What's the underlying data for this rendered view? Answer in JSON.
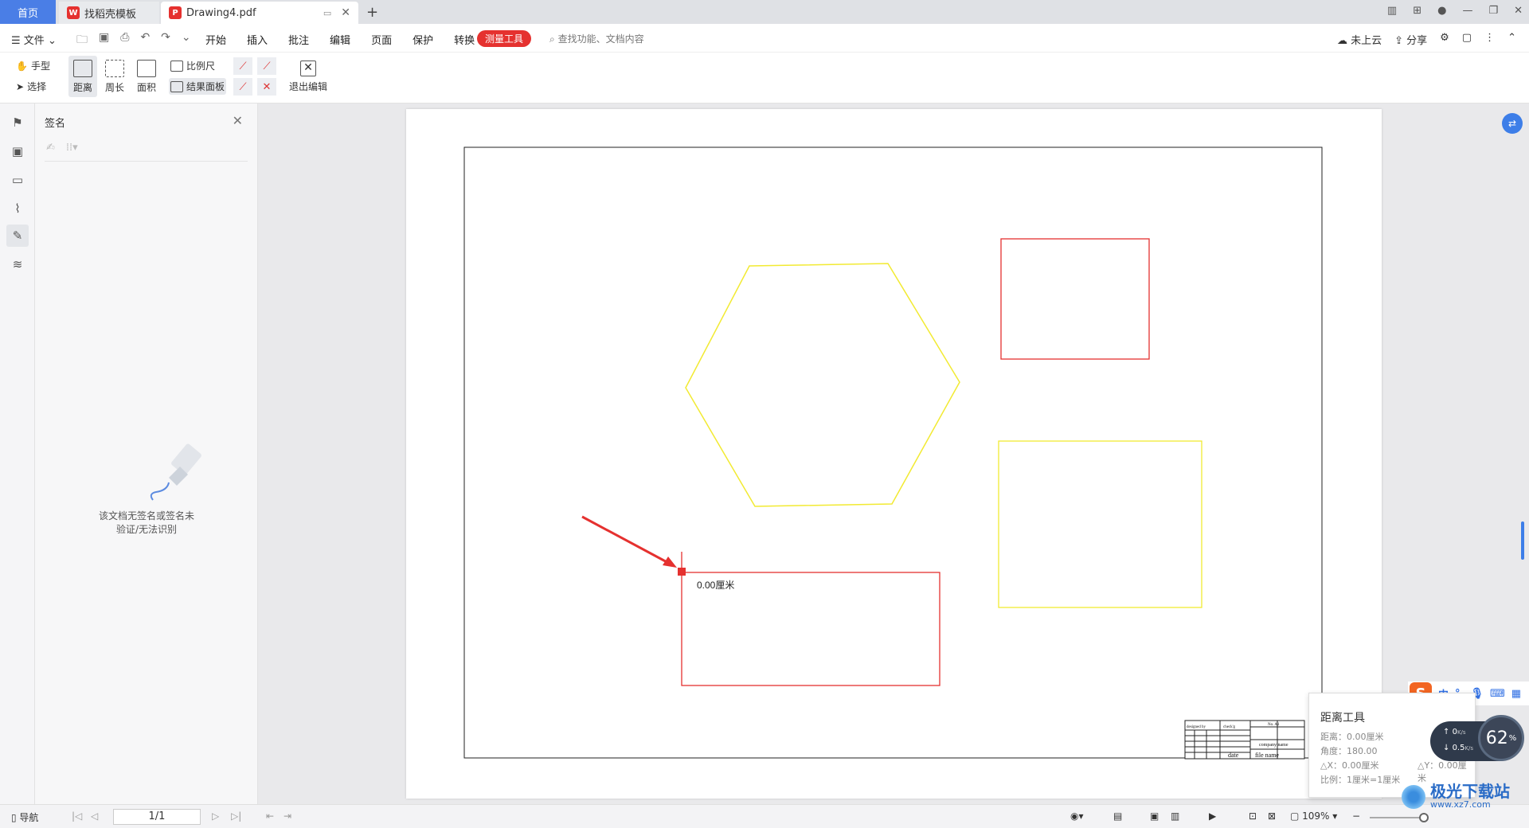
{
  "tabs": {
    "home": "首页",
    "template": "找稻壳模板",
    "doc": "Drawing4.pdf"
  },
  "menu": {
    "file": "文件",
    "items": [
      "开始",
      "插入",
      "批注",
      "编辑",
      "页面",
      "保护",
      "转换"
    ],
    "active": "测量工具",
    "search": "查找功能、文档内容",
    "cloud": "未上云",
    "share": "分享"
  },
  "ribbon": {
    "hand": "手型",
    "select": "选择",
    "distance": "距离",
    "perimeter": "周长",
    "area": "面积",
    "scale": "比例尺",
    "result_panel": "结果面板",
    "exit": "退出编辑"
  },
  "sign_panel": {
    "title": "签名",
    "empty_line1": "该文档无签名或签名未",
    "empty_line2": "验证/无法识别"
  },
  "drawing": {
    "measure_label": "0.00厘米",
    "title_block": {
      "designed_by": "designed by",
      "checked": "check'g",
      "no": "No. A1",
      "company": "company name",
      "date": "date",
      "file": "file name"
    }
  },
  "tooltip": {
    "title": "距离工具",
    "distance": "距离：0.00厘米",
    "angle": "角度：180.00",
    "dx": "△X：0.00厘米",
    "dy": "△Y：0.00厘米",
    "scale": "比例：1厘米=1厘米"
  },
  "ime": {
    "zh": "中",
    "punct": "°,"
  },
  "network": {
    "up": "0",
    "up_unit": "K/s",
    "down": "0.5",
    "down_unit": "K/s",
    "gauge": "62",
    "gauge_unit": "%"
  },
  "status": {
    "nav": "导航",
    "page": "1/1",
    "zoom": "109%"
  },
  "watermark": {
    "name": "极光下载站",
    "url": "www.xz7.com"
  }
}
